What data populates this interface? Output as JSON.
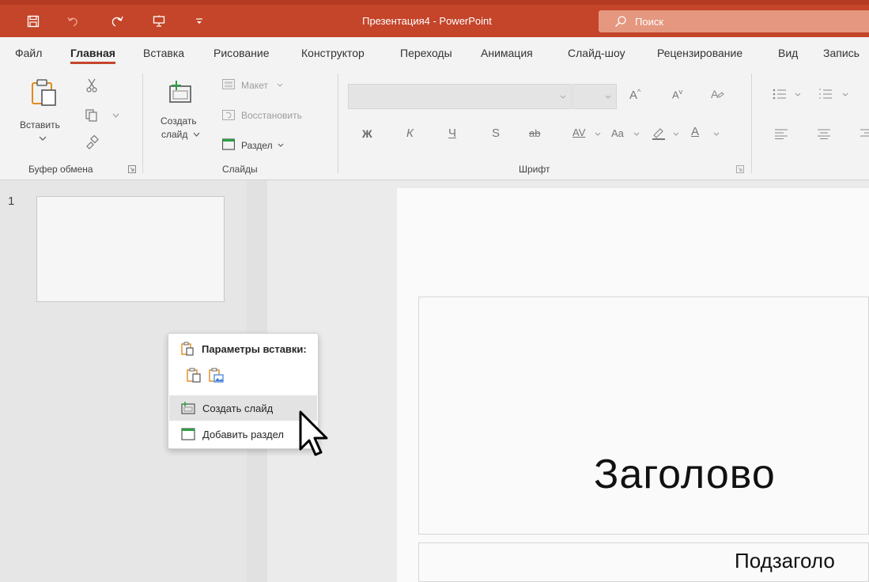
{
  "window": {
    "title": "Презентация4  -  PowerPoint",
    "search_placeholder": "Поиск",
    "accent_color": "#c4452a"
  },
  "quick_access": [
    "save-icon",
    "undo-icon",
    "redo-icon",
    "start-presentation-icon",
    "customize-qat-icon"
  ],
  "tabs": [
    {
      "label": "Файл"
    },
    {
      "label": "Главная",
      "active": true
    },
    {
      "label": "Вставка"
    },
    {
      "label": "Рисование"
    },
    {
      "label": "Конструктор"
    },
    {
      "label": "Переходы"
    },
    {
      "label": "Анимация"
    },
    {
      "label": "Слайд-шоу"
    },
    {
      "label": "Рецензирование"
    },
    {
      "label": "Вид"
    },
    {
      "label": "Запись"
    }
  ],
  "ribbon": {
    "clipboard": {
      "paste_label": "Вставить",
      "group_label": "Буфер обмена"
    },
    "slides": {
      "new_slide_line1": "Создать",
      "new_slide_line2": "слайд",
      "layout_label": "Макет",
      "reset_label": "Восстановить",
      "section_label": "Раздел",
      "group_label": "Слайды"
    },
    "font": {
      "bold": "Ж",
      "italic": "К",
      "underline": "Ч",
      "shadow": "S",
      "strike": "ab",
      "spacing": "AV",
      "case": "Aa",
      "font_color": "A",
      "grow": "A",
      "shrink": "A",
      "group_label": "Шрифт"
    }
  },
  "slide_pane": {
    "slide_number": "1"
  },
  "slide": {
    "title_text": "Заголово",
    "subtitle_text": "Подзаголо"
  },
  "context_menu": {
    "header": "Параметры вставки:",
    "items": [
      {
        "label": "Создать слайд",
        "icon": "new-slide-icon",
        "highlighted": true
      },
      {
        "label": "Добавить раздел",
        "icon": "add-section-icon",
        "highlighted": false
      }
    ]
  }
}
